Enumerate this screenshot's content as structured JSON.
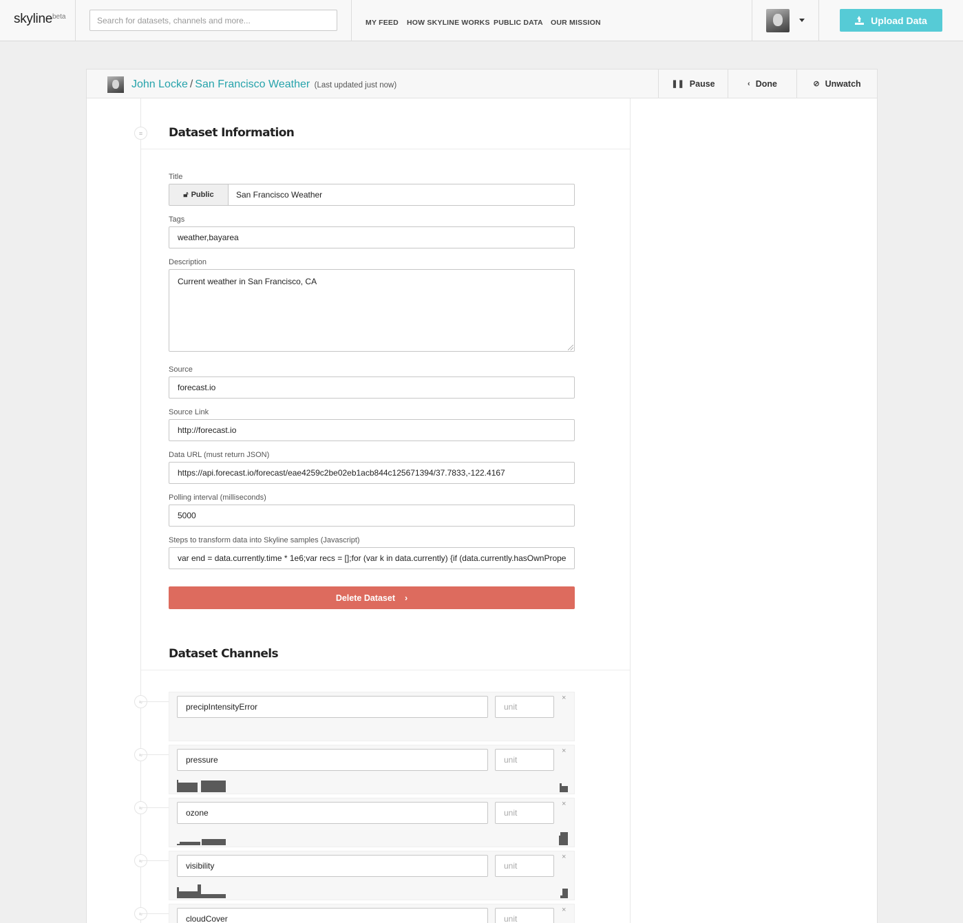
{
  "header": {
    "logo": "skyline",
    "logo_badge": "beta",
    "search_placeholder": "Search for datasets, channels and more...",
    "nav": [
      "MY FEED",
      "HOW SKYLINE WORKS",
      "PUBLIC DATA",
      "OUR MISSION"
    ],
    "upload_label": "Upload Data"
  },
  "dataset_header": {
    "owner": "John Locke",
    "separator": "/",
    "name": "San Francisco Weather",
    "updated": "(Last updated just now)",
    "pause_label": "Pause",
    "done_label": "Done",
    "unwatch_label": "Unwatch"
  },
  "info": {
    "section_title": "Dataset Information",
    "title_label": "Title",
    "visibility": "Public",
    "title_value": "San Francisco Weather",
    "tags_label": "Tags",
    "tags_value": "weather,bayarea",
    "description_label": "Description",
    "description_value": "Current weather in San Francisco, CA",
    "source_label": "Source",
    "source_value": "forecast.io",
    "source_link_label": "Source Link",
    "source_link_value": "http://forecast.io",
    "data_url_label": "Data URL (must return JSON)",
    "data_url_value": "https://api.forecast.io/forecast/eae4259c2be02eb1acb844c125671394/37.7833,-122.4167",
    "polling_label": "Polling interval (milliseconds)",
    "polling_value": "5000",
    "transform_label": "Steps to transform data into Skyline samples (Javascript)",
    "transform_value": "var end = data.currently.time * 1e6;var recs = [];for (var k in data.currently) {if (data.currently.hasOwnPrope",
    "delete_label": "Delete Dataset"
  },
  "channels": {
    "section_title": "Dataset Channels",
    "unit_placeholder": "unit",
    "remove_glyph": "×",
    "items": [
      {
        "name": "precipIntensityError"
      },
      {
        "name": "pressure"
      },
      {
        "name": "ozone"
      },
      {
        "name": "visibility"
      },
      {
        "name": "cloudCover"
      }
    ]
  },
  "icons": {
    "upload": "upload-icon",
    "pause": "pause-icon",
    "done": "chevron-left-icon",
    "unwatch": "eye-slash-icon",
    "public": "unlock-icon",
    "dataset_rail": "database-icon",
    "channel_rail": "chart-line-icon"
  },
  "colors": {
    "accent": "#56cbd6",
    "link": "#26a3ab",
    "danger": "#dd6b5e"
  }
}
